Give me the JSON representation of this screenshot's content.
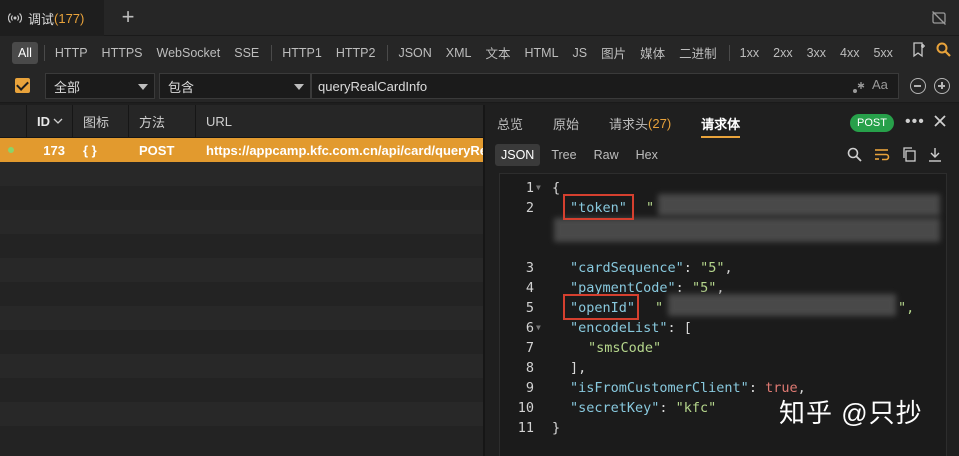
{
  "titlebar": {
    "tab_title": "调试",
    "tab_count": "(177)",
    "new_tab_label": "+"
  },
  "filters": {
    "protocols": [
      "All",
      "HTTP",
      "HTTPS",
      "WebSocket",
      "SSE",
      "HTTP1",
      "HTTP2",
      "JSON",
      "XML",
      "文本",
      "HTML",
      "JS",
      "图片",
      "媒体",
      "二进制"
    ],
    "status": [
      "1xx",
      "2xx",
      "3xx",
      "4xx",
      "5xx"
    ],
    "active": "All"
  },
  "search": {
    "scope": "全部",
    "mode": "包含",
    "query": "queryRealCardInfo",
    "case_label": "Aa"
  },
  "list": {
    "columns": [
      "ID",
      "图标",
      "方法",
      "URL"
    ],
    "rows": [
      {
        "id": "173",
        "icon": "{ }",
        "method": "POST",
        "url": "https://appcamp.kfc.com.cn/api/card/queryRealCardInfo"
      }
    ]
  },
  "detail": {
    "tabs": [
      {
        "label": "总览",
        "count": ""
      },
      {
        "label": "原始",
        "count": ""
      },
      {
        "label": "请求头",
        "count": "(27)"
      },
      {
        "label": "请求体",
        "count": ""
      }
    ],
    "active_tab": "请求体",
    "method_badge": "POST",
    "view_tabs": [
      "JSON",
      "Tree",
      "Raw",
      "Hex"
    ],
    "active_view": "JSON",
    "body_lines": [
      {
        "n": "1",
        "fold": true
      },
      {
        "n": "2",
        "fold": false
      },
      {
        "n": "3",
        "fold": false
      },
      {
        "n": "4",
        "fold": false
      },
      {
        "n": "5",
        "fold": false
      },
      {
        "n": "6",
        "fold": true
      },
      {
        "n": "7",
        "fold": false
      },
      {
        "n": "8",
        "fold": false
      },
      {
        "n": "9",
        "fold": false
      },
      {
        "n": "10",
        "fold": false
      },
      {
        "n": "11",
        "fold": false
      }
    ],
    "body": {
      "open": "{",
      "token_key": "\"token\"",
      "cardSequence_key": "\"cardSequence\"",
      "cardSequence_val": "\"5\"",
      "paymentCode_key": "\"paymentCode\"",
      "paymentCode_val": "\"5\"",
      "openId_key": "\"openId\"",
      "encodeList_key": "\"encodeList\"",
      "encodeList_item": "\"smsCode\"",
      "isFromCustomerClient_key": "\"isFromCustomerClient\"",
      "isFromCustomerClient_val": "true",
      "secretKey_key": "\"secretKey\"",
      "secretKey_val": "\"kfc\"",
      "close": "}"
    }
  },
  "watermark": "知乎 @只抄",
  "colors": {
    "accent": "#e9a33b",
    "selected_row": "#e29a2e",
    "post_badge": "#27a04a",
    "highlight_box": "#d5402f"
  }
}
